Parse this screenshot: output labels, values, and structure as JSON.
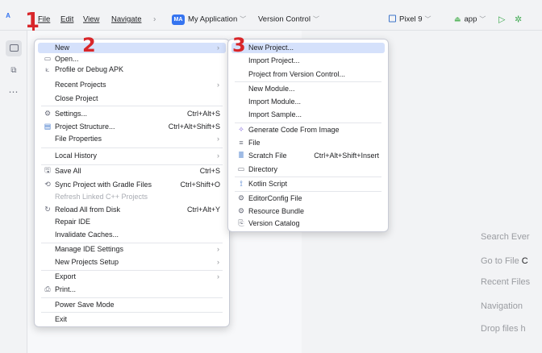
{
  "menubar": {
    "logo": "A",
    "file": "File",
    "edit": "Edit",
    "view": "View",
    "navigate": "Navigate",
    "breadcrumb_sep": "›",
    "project_badge": "MA",
    "project_name": "My Application",
    "vcs": "Version Control",
    "device": "Pixel 9",
    "run_config": "app"
  },
  "annotations": {
    "a1": "1",
    "a2": "2",
    "a3": "3"
  },
  "file_menu": [
    {
      "label": "New",
      "submenu": true,
      "highlight": true
    },
    {
      "label": "Open...",
      "icon": "folder-icon"
    },
    {
      "label": "Profile or Debug APK",
      "icon": "profile-icon"
    },
    {
      "label": "Recent Projects",
      "submenu": true
    },
    {
      "label": "Close Project"
    },
    {
      "label": "Settings...",
      "icon": "gear-icon",
      "shortcut": "Ctrl+Alt+S"
    },
    {
      "label": "Project Structure...",
      "icon": "structure-icon",
      "shortcut": "Ctrl+Alt+Shift+S"
    },
    {
      "label": "File Properties",
      "submenu": true
    },
    {
      "label": "Local History",
      "submenu": true
    },
    {
      "label": "Save All",
      "icon": "save-icon",
      "shortcut": "Ctrl+S"
    },
    {
      "label": "Sync Project with Gradle Files",
      "icon": "sync-icon",
      "shortcut": "Ctrl+Shift+O"
    },
    {
      "label": "Refresh Linked C++ Projects",
      "disabled": true
    },
    {
      "label": "Reload All from Disk",
      "icon": "reload-icon",
      "shortcut": "Ctrl+Alt+Y"
    },
    {
      "label": "Repair IDE"
    },
    {
      "label": "Invalidate Caches..."
    },
    {
      "label": "Manage IDE Settings",
      "submenu": true
    },
    {
      "label": "New Projects Setup",
      "submenu": true
    },
    {
      "label": "Export",
      "submenu": true
    },
    {
      "label": "Print...",
      "icon": "print-icon"
    },
    {
      "label": "Power Save Mode"
    },
    {
      "label": "Exit"
    }
  ],
  "new_menu": [
    {
      "label": "New Project...",
      "highlight": true
    },
    {
      "label": "Import Project..."
    },
    {
      "label": "Project from Version Control..."
    },
    {
      "label": "New Module..."
    },
    {
      "label": "Import Module..."
    },
    {
      "label": "Import Sample..."
    },
    {
      "label": "Generate Code From Image",
      "icon": "sparkle-icon"
    },
    {
      "label": "File",
      "icon": "file-icon"
    },
    {
      "label": "Scratch File",
      "icon": "scratch-icon",
      "shortcut": "Ctrl+Alt+Shift+Insert"
    },
    {
      "label": "Directory",
      "icon": "folder-icon"
    },
    {
      "label": "Kotlin Script",
      "icon": "kotlin-icon"
    },
    {
      "label": "EditorConfig File",
      "icon": "gear-icon"
    },
    {
      "label": "Resource Bundle",
      "icon": "gear-icon"
    },
    {
      "label": "Version Catalog",
      "icon": "catalog-icon"
    }
  ],
  "editor_hints": {
    "search": "Search Ever",
    "goto_prefix": "Go to File ",
    "goto_key": "C",
    "recent": "Recent Files",
    "navigation": "Navigation",
    "drop": "Drop files h"
  },
  "colors": {
    "accent": "#3574f0",
    "highlight": "#d5e1fb",
    "annotation": "#d8262a"
  }
}
